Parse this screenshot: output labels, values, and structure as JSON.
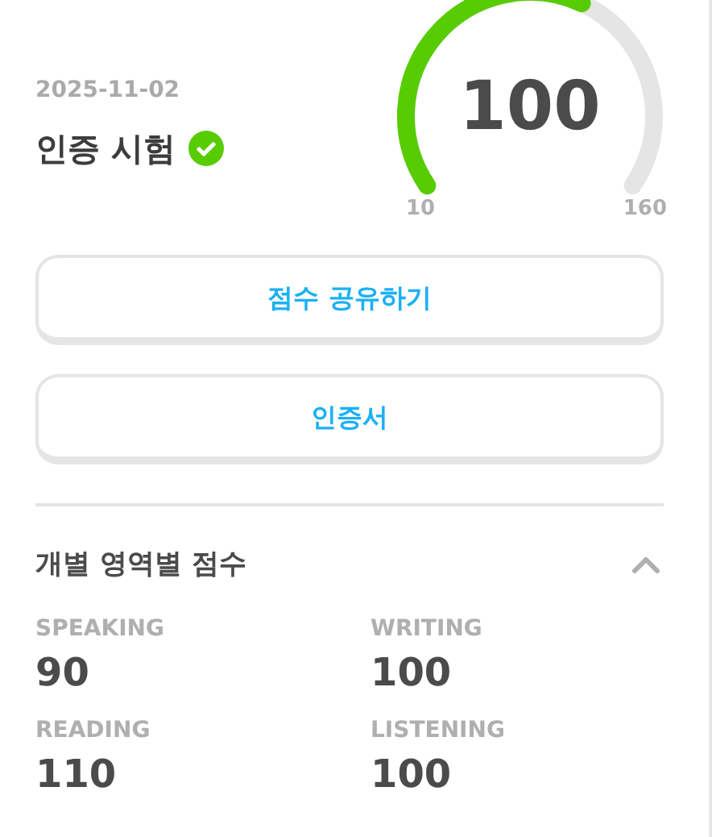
{
  "test": {
    "date": "2025-11-02",
    "title": "인증 시험",
    "verified": true
  },
  "gauge": {
    "score": "100",
    "min": "10",
    "max": "160"
  },
  "buttons": [
    "점수 공유하기",
    "인증서"
  ],
  "section": {
    "title": "개별 영역별 점수",
    "expanded": true
  },
  "scores": [
    {
      "label": "SPEAKING",
      "value": "90"
    },
    {
      "label": "WRITING",
      "value": "100"
    },
    {
      "label": "READING",
      "value": "110"
    },
    {
      "label": "LISTENING",
      "value": "100"
    }
  ]
}
